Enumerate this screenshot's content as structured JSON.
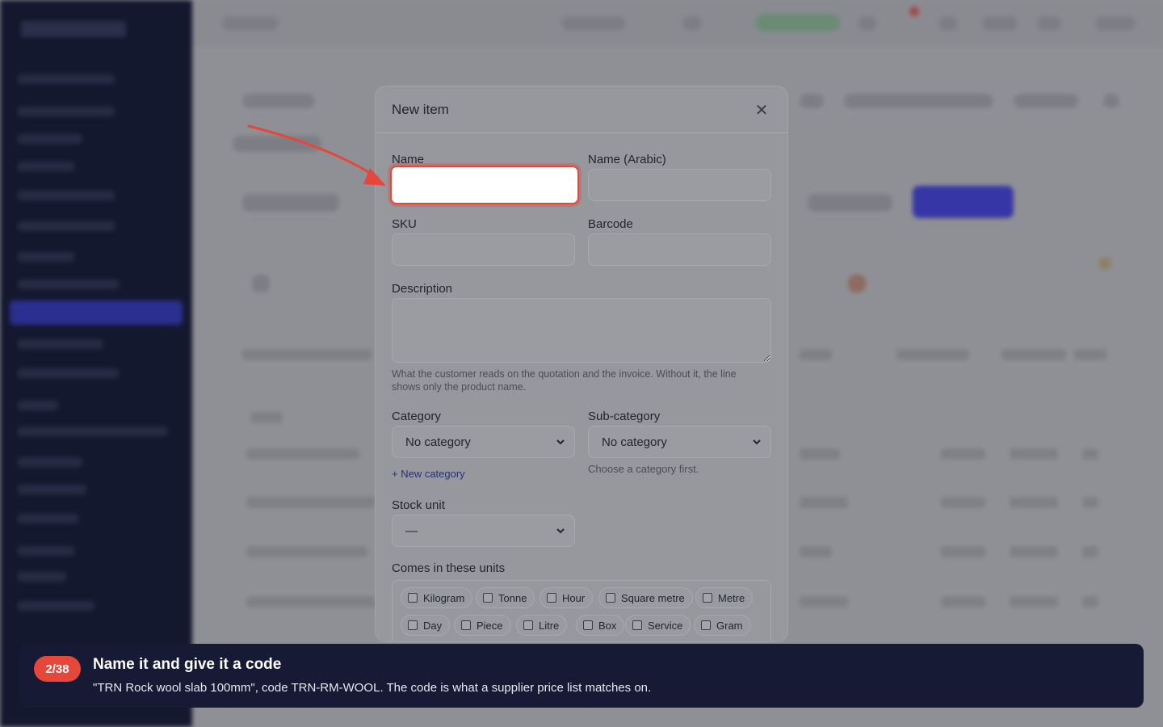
{
  "modal": {
    "title": "New item",
    "close_icon": "close-icon",
    "fields": {
      "name": {
        "label": "Name",
        "value": ""
      },
      "name_arabic": {
        "label": "Name (Arabic)",
        "value": ""
      },
      "sku": {
        "label": "SKU",
        "value": ""
      },
      "barcode": {
        "label": "Barcode",
        "value": ""
      },
      "description": {
        "label": "Description",
        "value": "",
        "help": "What the customer reads on the quotation and the invoice. Without it, the line shows only the product name."
      },
      "category": {
        "label": "Category",
        "selected": "No category",
        "link": "+ New category"
      },
      "subcategory": {
        "label": "Sub-category",
        "selected": "No category",
        "help": "Choose a category first."
      },
      "stock_unit": {
        "label": "Stock unit",
        "selected": "—"
      },
      "units": {
        "label": "Comes in these units",
        "options": [
          "Kilogram",
          "Tonne",
          "Hour",
          "Square metre",
          "Metre",
          "Day",
          "Piece",
          "Litre",
          "Box",
          "Service",
          "Gram"
        ]
      }
    }
  },
  "tour": {
    "step": "2/38",
    "title": "Name it and give it a code",
    "text": "\"TRN Rock wool slab 100mm\", code TRN-RM-WOOL. The code is what a supplier price list matches on."
  },
  "colors": {
    "highlight": "#e2483b",
    "tour_bg": "#161a35",
    "badge": "#e5473b"
  }
}
